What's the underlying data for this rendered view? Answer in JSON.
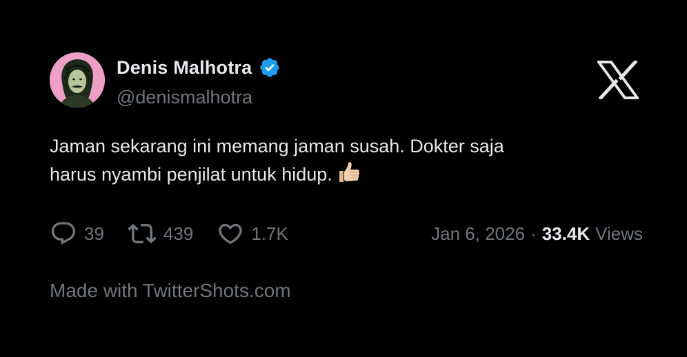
{
  "author": {
    "display_name": "Denis Malhotra",
    "handle": "@denismalhotra",
    "verified": true
  },
  "brand_icon": "x-logo-icon",
  "tweet": {
    "lines": [
      "Jaman sekarang ini memang jaman susah. Dokter saja",
      "harus nyambi penjilat untuk hidup."
    ],
    "emoji": "thumbs-up-icon"
  },
  "metrics": {
    "replies": "39",
    "retweets": "439",
    "likes": "1.7K"
  },
  "meta": {
    "date": "Jan 6, 2026",
    "separator": "·",
    "views_count": "33.4K",
    "views_label": "Views"
  },
  "footer": {
    "text": "Made with TwitterShots.com"
  },
  "colors": {
    "background": "#000000",
    "primary_text": "#e7e9ea",
    "secondary_text": "#71767b",
    "verified_blue": "#1d9bf0",
    "avatar_bg": "#f0a3c8"
  }
}
